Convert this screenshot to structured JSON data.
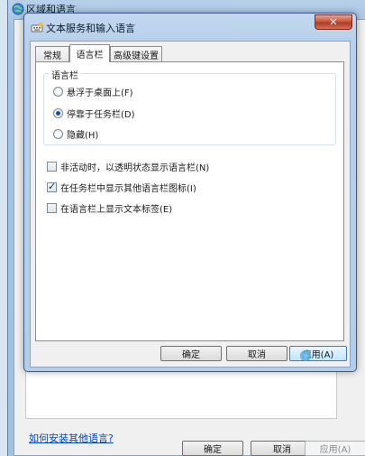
{
  "outer_window": {
    "title": "区域和语言",
    "link": "如何安装其他语言?",
    "buttons": {
      "ok": "确定",
      "cancel": "取消",
      "apply": "应用(A)"
    }
  },
  "dialog": {
    "title": "文本服务和输入语言",
    "close_glyph": "✕",
    "tabs": [
      {
        "label": "常规"
      },
      {
        "label": "语言栏",
        "active": true
      },
      {
        "label": "高级键设置"
      }
    ],
    "language_bar": {
      "group_title": "语言栏",
      "options": [
        {
          "label": "悬浮于桌面上(F)",
          "selected": false
        },
        {
          "label": "停靠于任务栏(D)",
          "selected": true
        },
        {
          "label": "隐藏(H)",
          "selected": false
        }
      ],
      "checkboxes": [
        {
          "label": "非活动时，以透明状态显示语言栏(N)",
          "checked": false
        },
        {
          "label": "在任务栏中显示其他语言栏图标(I)",
          "checked": true
        },
        {
          "label": "在语言栏上显示文本标签(E)",
          "checked": false
        }
      ]
    },
    "buttons": {
      "ok": "确定",
      "cancel": "取消",
      "apply": "应用(A)"
    }
  },
  "colors": {
    "arrow": "#d42a2a",
    "link": "#0645ad",
    "title_bar": "#b8d0ec"
  },
  "icons": [
    "globe-icon",
    "keyboard-icon",
    "close-icon",
    "annotation-arrow"
  ]
}
